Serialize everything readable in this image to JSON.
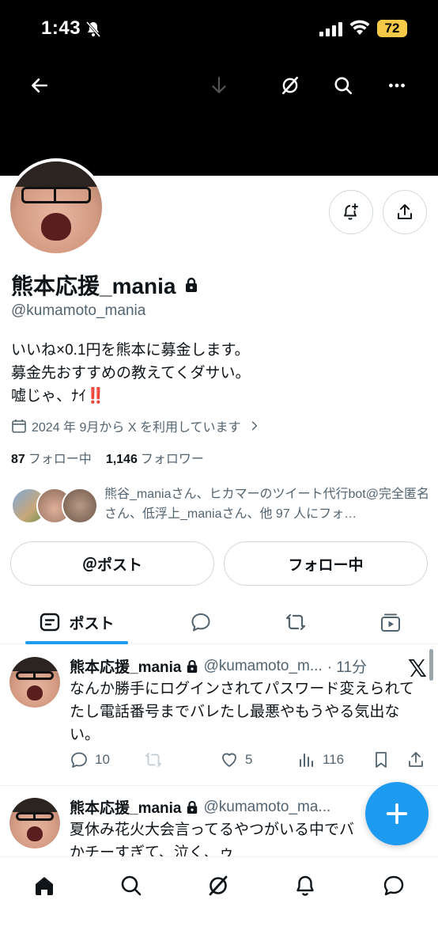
{
  "status_bar": {
    "time": "1:43",
    "battery": "72"
  },
  "profile": {
    "name": "熊本応援_mania",
    "handle": "@kumamoto_mania",
    "bio_lines": [
      "いいね×0.1円を熊本に募金します。",
      "募金先おすすめの教えてくダサい。",
      "嘘じゃ、ﾅｲ‼️"
    ],
    "joined": "2024 年 9月から X を利用しています",
    "following_count": "87",
    "following_label": "フォロー中",
    "followers_count": "1,146",
    "followers_label": "フォロワー",
    "known_followers": "熊谷_maniaさん、ヒカマーのツイート代行bot@完全匿名さん、低浮上_maniaさん、他 97 人にフォ…"
  },
  "buttons": {
    "post": "＠ポスト",
    "following": "フォロー中"
  },
  "tabs": [
    {
      "label": "ポスト",
      "icon": "posts-icon"
    },
    {
      "icon": "replies-icon"
    },
    {
      "icon": "retweet-icon"
    },
    {
      "icon": "media-icon"
    }
  ],
  "tweets": [
    {
      "name": "熊本応援_mania",
      "handle": "@kumamoto_m...",
      "time": "· 11分",
      "text": "なんか勝手にログインされてパスワード変えられてたし電話番号までバレたし最悪やもうやる気出ない。",
      "replies": "10",
      "likes": "5",
      "views": "116"
    },
    {
      "name": "熊本応援_mania",
      "handle": "@kumamoto_ma...",
      "text": "夏休み花火大会言ってるやつがいる中でバかチーすぎて、泣く、ゥ"
    }
  ],
  "colors": {
    "accent": "#1d9bf0",
    "text": "#0f1419",
    "secondary": "#536471",
    "border": "#cfd9de",
    "alert_red": "#e0245e"
  }
}
